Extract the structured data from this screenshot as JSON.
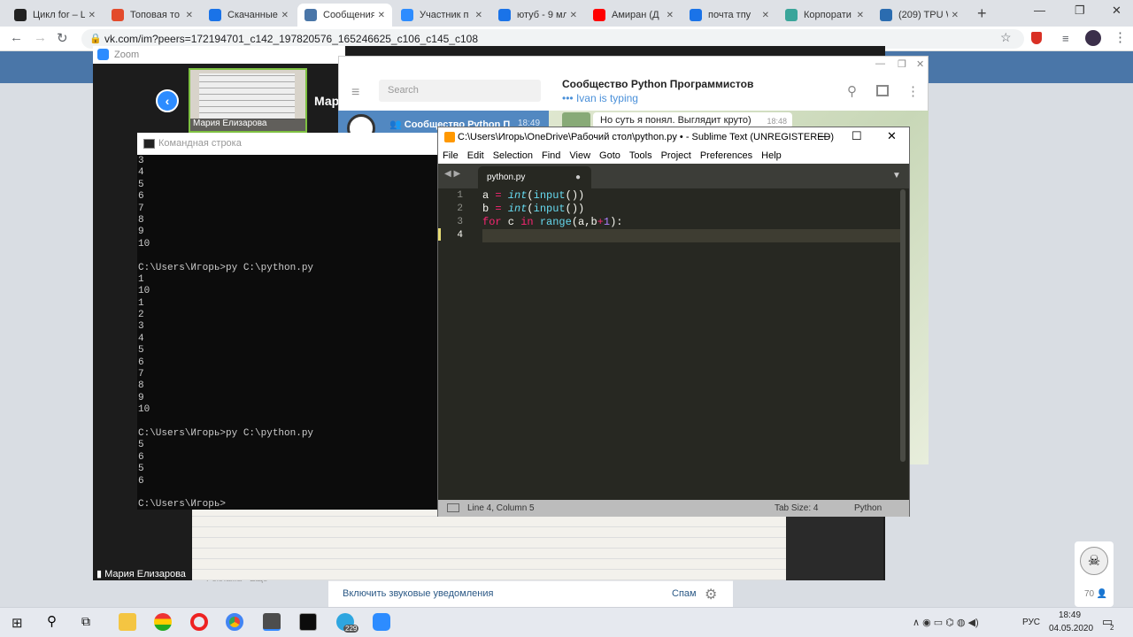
{
  "browser": {
    "tabs": [
      {
        "label": "Цикл for – L",
        "color": "#222"
      },
      {
        "label": "Топовая то",
        "color": "#e34b2c"
      },
      {
        "label": "Скачанные",
        "color": "#1a73e8"
      },
      {
        "label": "Сообщения",
        "color": "#4a76a8"
      },
      {
        "label": "Участник п",
        "color": "#2d8cff"
      },
      {
        "label": "ютуб - 9 мл",
        "color": "#1a73e8"
      },
      {
        "label": "Амиран (Д",
        "color": "#f00"
      },
      {
        "label": "почта тпу",
        "color": "#1a73e8"
      },
      {
        "label": "Корпорати",
        "color": "#3aa59a"
      },
      {
        "label": "(209) TPU W",
        "color": "#2b6cb0"
      }
    ],
    "url": "vk.com/im?peers=172194701_c142_197820576_165246625_c106_c145_c108"
  },
  "zoom": {
    "title": "Zoom",
    "thumb_name": "Мария Елизарова",
    "bottom_name": "Мария Елизарова",
    "cut_name": "Мар"
  },
  "telegram": {
    "search_placeholder": "Search",
    "chat_title": "Сообщество Python Программистов",
    "typing": "Ivan is typing",
    "dialog_name": "Сообщество Python П",
    "dialog_time": "18:49",
    "message_text": "Но суть я понял. Выглядит круто)",
    "message_time": "18:48"
  },
  "cmd": {
    "title": "Командная строка",
    "lines": [
      "3",
      "4",
      "5",
      "6",
      "7",
      "8",
      "9",
      "10",
      "",
      "C:\\Users\\Игорь>py C:\\python.py",
      "1",
      "10",
      "1",
      "2",
      "3",
      "4",
      "5",
      "6",
      "7",
      "8",
      "9",
      "10",
      "",
      "C:\\Users\\Игорь>py C:\\python.py",
      "5",
      "6",
      "5",
      "6",
      "",
      "C:\\Users\\Игорь>"
    ]
  },
  "sublime": {
    "title": "C:\\Users\\Игорь\\OneDrive\\Рабочий стол\\python.py • - Sublime Text (UNREGISTERED)",
    "menu": [
      "File",
      "Edit",
      "Selection",
      "Find",
      "View",
      "Goto",
      "Tools",
      "Project",
      "Preferences",
      "Help"
    ],
    "tab": "python.py",
    "line_numbers": [
      "1",
      "2",
      "3",
      "4"
    ],
    "status_pos": "Line 4, Column 5",
    "status_tab": "Tab Size: 4",
    "status_lang": "Python"
  },
  "vk": {
    "notif": "Включить звуковые уведомления",
    "spam": "Спам",
    "ads": "Реклама · Ещё",
    "count": "70"
  },
  "taskbar": {
    "lang": "РУС",
    "time": "18:49",
    "date": "04.05.2020",
    "notif_count": "2",
    "tg_badge": "229"
  }
}
